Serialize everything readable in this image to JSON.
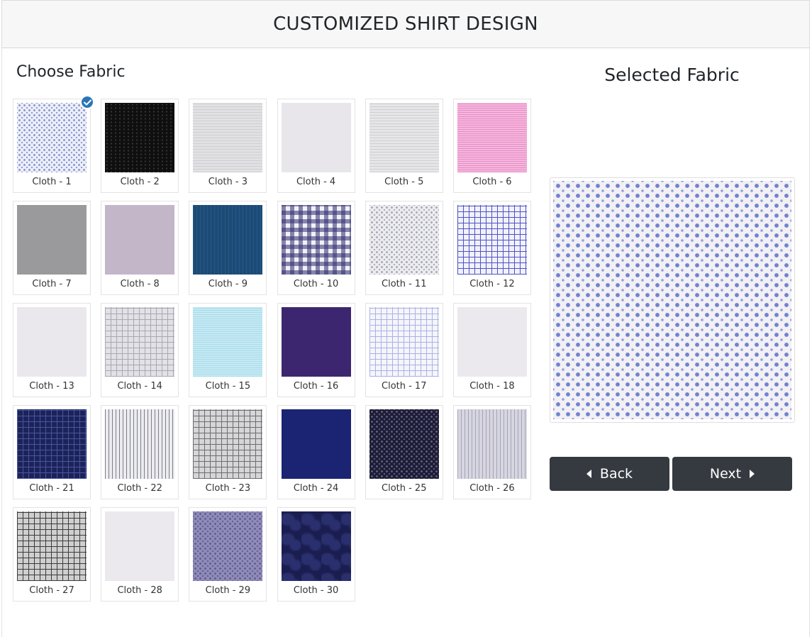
{
  "header": {
    "title": "CUSTOMIZED SHIRT DESIGN"
  },
  "left": {
    "title": "Choose Fabric"
  },
  "right": {
    "title": "Selected Fabric",
    "selected_index": 0
  },
  "buttons": {
    "back_label": "Back",
    "next_label": "Next"
  },
  "icons": {
    "back": "caret-left-icon",
    "next": "caret-right-icon",
    "selected": "check-circle-icon"
  },
  "accent_color": "#2a76b5",
  "fabrics": [
    {
      "label": "Cloth - 1",
      "color": "#eceef8",
      "pattern": "dots",
      "accent": "#8c97d0"
    },
    {
      "label": "Cloth - 2",
      "color": "#0f0f10",
      "pattern": "speck",
      "accent": "#3a3a3a"
    },
    {
      "label": "Cloth - 3",
      "color": "#e1e0e3",
      "pattern": "fine",
      "accent": "#cfced2"
    },
    {
      "label": "Cloth - 4",
      "color": "#e9e6eb",
      "pattern": "plain",
      "accent": "#dcd8de"
    },
    {
      "label": "Cloth - 5",
      "color": "#e6e6e8",
      "pattern": "fine",
      "accent": "#cfcfd3"
    },
    {
      "label": "Cloth - 6",
      "color": "#f4b7dd",
      "pattern": "hstripe",
      "accent": "#e98cc6"
    },
    {
      "label": "Cloth - 7",
      "color": "#9a9a9c",
      "pattern": "plain",
      "accent": "#8d8d90"
    },
    {
      "label": "Cloth - 8",
      "color": "#c3b6c9",
      "pattern": "plain",
      "accent": "#b5a7bc"
    },
    {
      "label": "Cloth - 9",
      "color": "#1d4a76",
      "pattern": "vstripe",
      "accent": "#245887"
    },
    {
      "label": "Cloth - 10",
      "color": "#f1f0f6",
      "pattern": "gingham",
      "accent": "#2f2c6e"
    },
    {
      "label": "Cloth - 11",
      "color": "#ecebef",
      "pattern": "dots",
      "accent": "#a9aab8"
    },
    {
      "label": "Cloth - 12",
      "color": "#f1f1fa",
      "pattern": "check",
      "accent": "#4e53c4"
    },
    {
      "label": "Cloth - 13",
      "color": "#eae7ed",
      "pattern": "plain",
      "accent": "#e0dce4"
    },
    {
      "label": "Cloth - 14",
      "color": "#e2e1e6",
      "pattern": "check",
      "accent": "#a8a8b4"
    },
    {
      "label": "Cloth - 15",
      "color": "#c6e9f3",
      "pattern": "hstripe",
      "accent": "#a7dbea"
    },
    {
      "label": "Cloth - 16",
      "color": "#3d2670",
      "pattern": "plain",
      "accent": "#33205f"
    },
    {
      "label": "Cloth - 17",
      "color": "#f5f5fa",
      "pattern": "check",
      "accent": "#a9b2e6"
    },
    {
      "label": "Cloth - 18",
      "color": "#ebe9ee",
      "pattern": "plain",
      "accent": "#e2e0e6"
    },
    {
      "label": "Cloth - 21",
      "color": "#1c2358",
      "pattern": "check",
      "accent": "#4a55a0"
    },
    {
      "label": "Cloth - 22",
      "color": "#ececf0",
      "pattern": "vstripe",
      "accent": "#7e7e8a"
    },
    {
      "label": "Cloth - 23",
      "color": "#d6d6d8",
      "pattern": "check",
      "accent": "#6c6c72"
    },
    {
      "label": "Cloth - 24",
      "color": "#1b2373",
      "pattern": "plain",
      "accent": "#1a2168"
    },
    {
      "label": "Cloth - 25",
      "color": "#1e1d36",
      "pattern": "dots",
      "accent": "#5e5d80"
    },
    {
      "label": "Cloth - 26",
      "color": "#d7d6e0",
      "pattern": "vstripe",
      "accent": "#a5a4b7"
    },
    {
      "label": "Cloth - 27",
      "color": "#cfcfcf",
      "pattern": "check",
      "accent": "#3b3b3b"
    },
    {
      "label": "Cloth - 28",
      "color": "#ece9ee",
      "pattern": "plain",
      "accent": "#e3e0e6"
    },
    {
      "label": "Cloth - 29",
      "color": "#8e8bb6",
      "pattern": "dots",
      "accent": "#5f5c98"
    },
    {
      "label": "Cloth - 30",
      "color": "#1a1d4f",
      "pattern": "paisley",
      "accent": "#2a2f6e"
    }
  ]
}
